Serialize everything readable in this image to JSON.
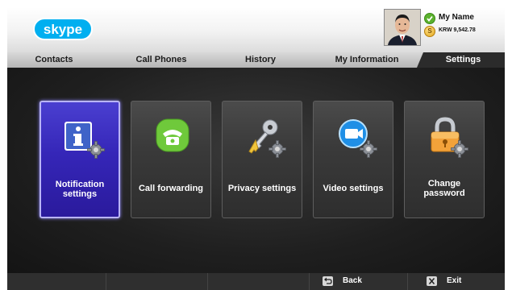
{
  "header": {
    "logo_text": "skype",
    "user": {
      "name": "My Name",
      "credit": "KRW 9,542.78",
      "credit_symbol": "S"
    }
  },
  "tabs": [
    {
      "label": "Contacts"
    },
    {
      "label": "Call Phones"
    },
    {
      "label": "History"
    },
    {
      "label": "My Information"
    },
    {
      "label": "Settings",
      "active": true
    }
  ],
  "settings_tiles": [
    {
      "line1": "Notification",
      "line2": "settings",
      "icon": "info-icon",
      "selected": true
    },
    {
      "line1": "Call forwarding",
      "line2": "",
      "icon": "phone-icon"
    },
    {
      "line1": "Privacy settings",
      "line2": "",
      "icon": "key-icon"
    },
    {
      "line1": "Video settings",
      "line2": "",
      "icon": "video-icon"
    },
    {
      "line1": "Change",
      "line2": "password",
      "icon": "lock-icon"
    }
  ],
  "footer": {
    "back_label": "Back",
    "exit_label": "Exit"
  },
  "colors": {
    "brand": "#00aff0",
    "selected_tile": "#3526b8",
    "status_online": "#5bb12e"
  }
}
